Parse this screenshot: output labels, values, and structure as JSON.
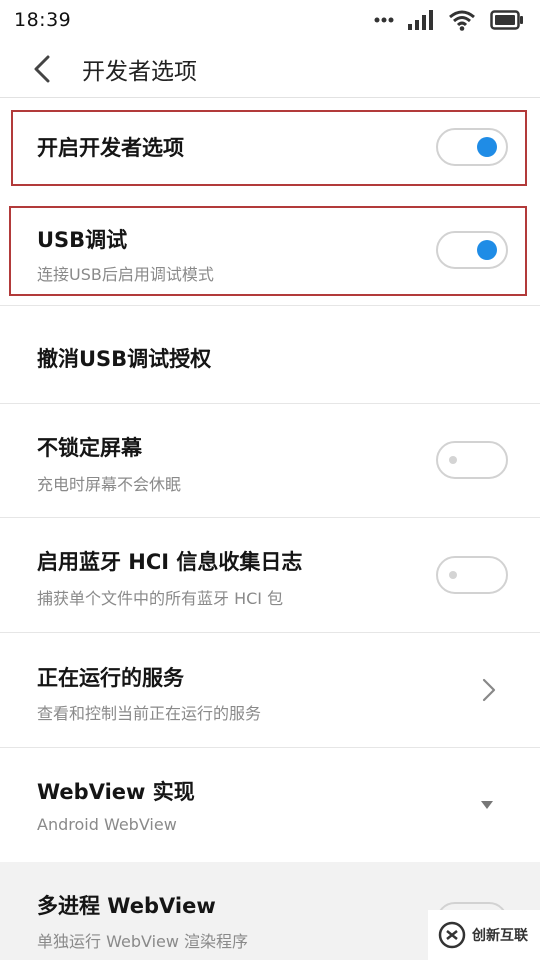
{
  "status_bar": {
    "time": "18:39",
    "icons": [
      "more-dots-icon",
      "signal-icon",
      "wifi-icon",
      "battery-icon"
    ]
  },
  "header": {
    "back_icon": "back-chevron-icon",
    "title": "开发者选项"
  },
  "settings": [
    {
      "title": "开启开发者选项",
      "subtitle": "",
      "control": "toggle",
      "enabled": true,
      "highlighted": true
    },
    {
      "title": "USB调试",
      "subtitle": "连接USB后启用调试模式",
      "control": "toggle",
      "enabled": true,
      "highlighted": true
    },
    {
      "title": "撤消USB调试授权",
      "subtitle": "",
      "control": "none"
    },
    {
      "title": "不锁定屏幕",
      "subtitle": "充电时屏幕不会休眠",
      "control": "toggle",
      "enabled": false
    },
    {
      "title": "启用蓝牙 HCI 信息收集日志",
      "subtitle": "捕获单个文件中的所有蓝牙 HCI 包",
      "control": "toggle",
      "enabled": false
    },
    {
      "title": "正在运行的服务",
      "subtitle": "查看和控制当前正在运行的服务",
      "control": "chevron"
    },
    {
      "title": "WebView 实现",
      "subtitle": "Android WebView",
      "control": "dropdown"
    },
    {
      "title": "多进程 WebView",
      "subtitle": "单独运行 WebView 渲染程序",
      "control": "toggle",
      "enabled": false
    }
  ],
  "watermark": {
    "text": "创新互联"
  },
  "colors": {
    "accent": "#1f8ce6",
    "highlight": "#b23a3a",
    "divider": "#e6e6e6"
  }
}
